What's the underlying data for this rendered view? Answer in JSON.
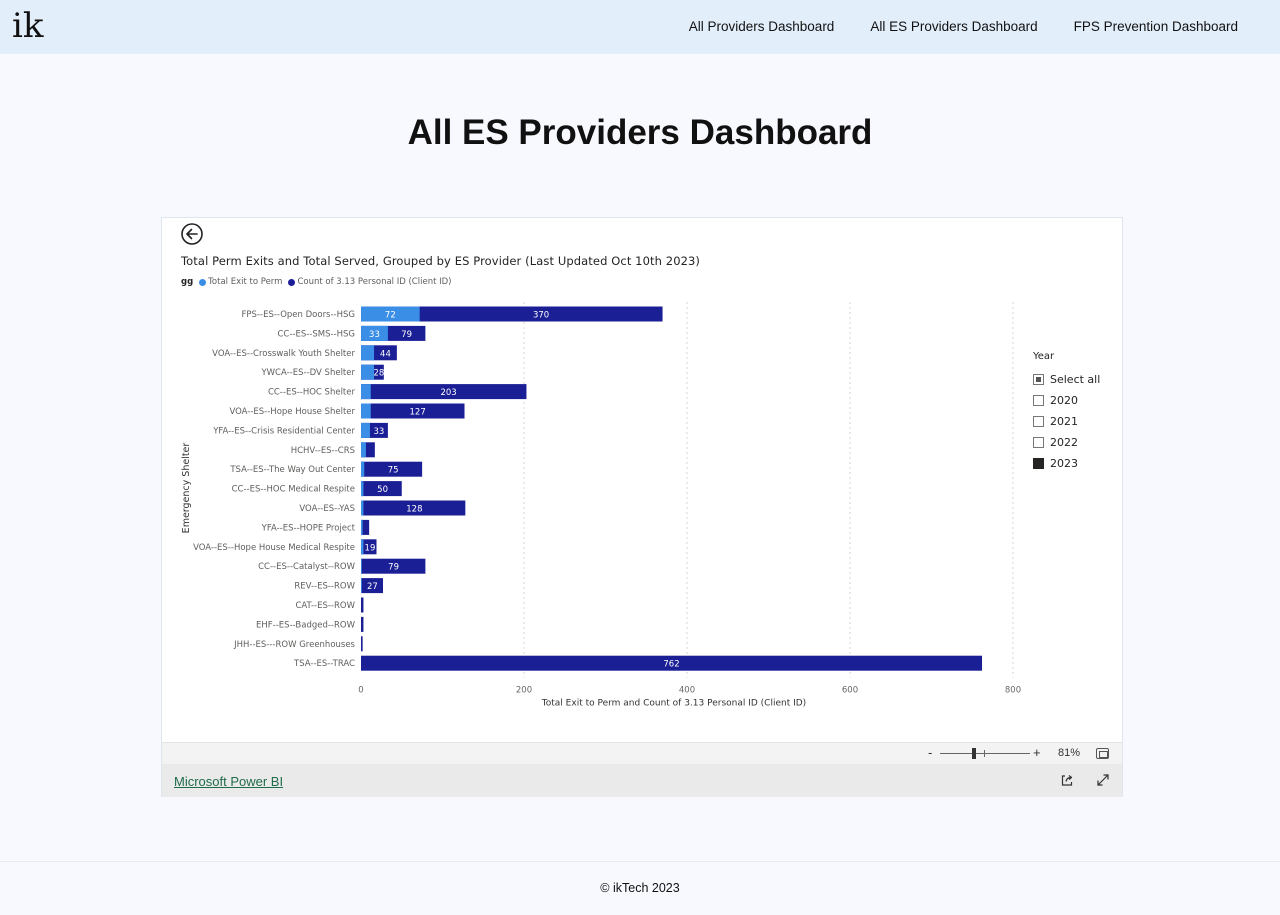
{
  "site": {
    "logo": "ik",
    "nav": [
      "All Providers Dashboard",
      "All ES Providers Dashboard",
      "FPS Prevention Dashboard"
    ],
    "page_title": "All ES Providers Dashboard",
    "footer": "© ikTech 2023"
  },
  "report": {
    "back_icon": "arrow-left-circle-icon",
    "slicer": {
      "title": "Year",
      "options": [
        {
          "label": "Select all",
          "state": "partial"
        },
        {
          "label": "2020",
          "state": "unchecked"
        },
        {
          "label": "2021",
          "state": "unchecked"
        },
        {
          "label": "2022",
          "state": "unchecked"
        },
        {
          "label": "2023",
          "state": "checked"
        }
      ]
    },
    "zoom": {
      "minus": "-",
      "plus": "+",
      "level": "81%",
      "level_value": 81
    },
    "footer_link": "Microsoft Power BI",
    "icons": [
      "fit-to-page-icon",
      "share-icon",
      "expand-icon"
    ]
  },
  "chart_data": {
    "type": "bar",
    "orientation": "horizontal",
    "title": "Total Perm Exits and Total Served, Grouped by ES Provider (Last Updated Oct 10th 2023)",
    "legend_title": "gg",
    "xlabel": "Total Exit to Perm and Count of 3.13 Personal ID (Client ID)",
    "ylabel": "Emergency Shelter",
    "xlim": [
      0,
      800
    ],
    "xticks": [
      0,
      200,
      400,
      600,
      800
    ],
    "grid": "vertical dotted",
    "legend_position": "top-left",
    "categories": [
      "FPS--ES--Open Doors--HSG",
      "CC--ES--SMS--HSG",
      "VOA--ES--Crosswalk Youth Shelter",
      "YWCA--ES--DV Shelter",
      "CC--ES--HOC Shelter",
      "VOA--ES--Hope House Shelter",
      "YFA--ES--Crisis Residential Center",
      "HCHV--ES--CRS",
      "TSA--ES--The Way Out Center",
      "CC--ES--HOC Medical Respite",
      "VOA--ES--YAS",
      "YFA--ES--HOPE Project",
      "VOA--ES--Hope House Medical Respite",
      "CC--ES--Catalyst--ROW",
      "REV--ES--ROW",
      "CAT--ES--ROW",
      "EHF--ES--Badged--ROW",
      "JHH--ES---ROW Greenhouses",
      "TSA--ES--TRAC"
    ],
    "series": [
      {
        "name": "Total Exit to Perm",
        "color": "#3a8ee6",
        "values": [
          72,
          33,
          16,
          16,
          12,
          12,
          11,
          6,
          4,
          3,
          3,
          2,
          3,
          1,
          1,
          0,
          0,
          0,
          0
        ],
        "labels": [
          "72",
          "33",
          "",
          "",
          "",
          "",
          "",
          "",
          "",
          "",
          "",
          "",
          "",
          "",
          "",
          "",
          "",
          "",
          ""
        ]
      },
      {
        "name": "Count of 3.13 Personal ID (Client ID)",
        "color": "#1b1f96",
        "values": [
          370,
          79,
          44,
          28,
          203,
          127,
          33,
          17,
          75,
          50,
          128,
          10,
          19,
          79,
          27,
          3,
          3,
          2,
          762
        ],
        "labels": [
          "370",
          "79",
          "44",
          "28",
          "203",
          "127",
          "33",
          "",
          "75",
          "50",
          "128",
          "",
          "19",
          "79",
          "27",
          "",
          "",
          "",
          "762"
        ]
      }
    ]
  }
}
